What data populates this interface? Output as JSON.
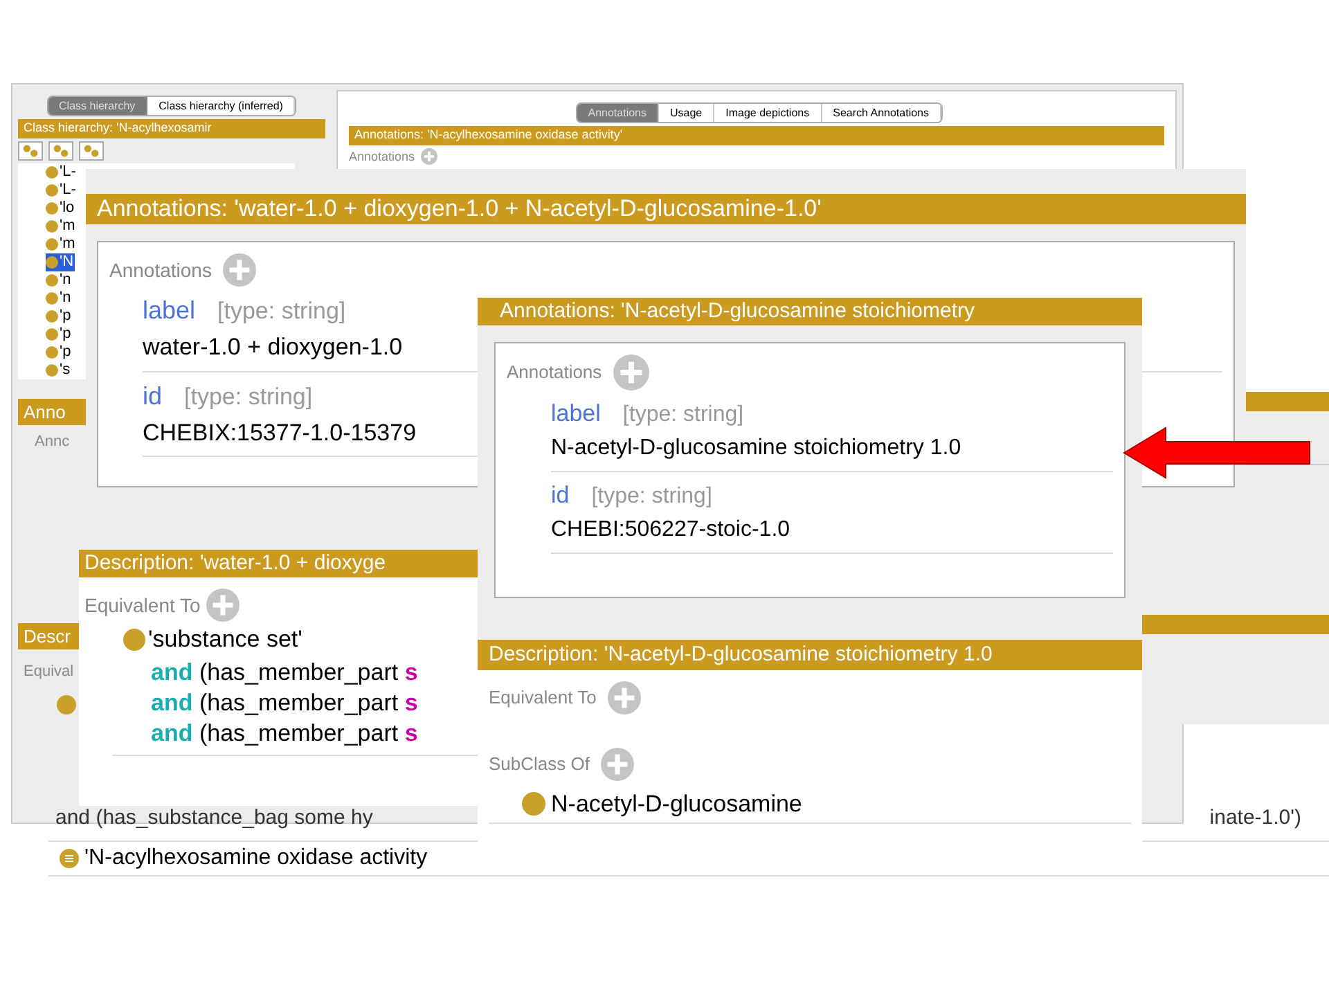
{
  "back_window": {
    "hierarchy_tabs": [
      {
        "label": "Class hierarchy",
        "selected": true
      },
      {
        "label": "Class hierarchy (inferred)",
        "selected": false
      }
    ],
    "hierarchy_header": "Class hierarchy: 'N-acylhexosamir",
    "tree_items": [
      {
        "label": "'L-",
        "selected": false
      },
      {
        "label": "'L-",
        "selected": false
      },
      {
        "label": "'lo",
        "selected": false
      },
      {
        "label": "'m",
        "selected": false
      },
      {
        "label": "'m",
        "selected": false
      },
      {
        "label": "'N",
        "selected": true
      },
      {
        "label": "'n",
        "selected": false
      },
      {
        "label": "'n",
        "selected": false
      },
      {
        "label": "'p",
        "selected": false
      },
      {
        "label": "'p",
        "selected": false
      },
      {
        "label": "'p",
        "selected": false
      },
      {
        "label": "'s",
        "selected": false
      }
    ],
    "annotation_tabs": [
      {
        "label": "Annotations",
        "selected": true
      },
      {
        "label": "Usage",
        "selected": false
      },
      {
        "label": "Image depictions",
        "selected": false
      },
      {
        "label": "Search Annotations",
        "selected": false
      }
    ],
    "annotations_header": "Annotations: 'N-acylhexosamine oxidase activity'",
    "annotations_label": "Annotations",
    "lower_header": "Anno",
    "lower_annotations_label": "Annc",
    "description_header": "Descr",
    "equivalent_label": "Equival",
    "bottom_rows": [
      "and (has_substance_bag some hy",
      "inate-1.0')"
    ],
    "class_row": "'N-acylhexosamine oxidase activity"
  },
  "reaction_window": {
    "annotations_header": "Annotations: 'water-1.0 + dioxygen-1.0 + N-acetyl-D-glucosamine-1.0'",
    "annotations_label": "Annotations",
    "annotations": [
      {
        "property": "label",
        "type": "[type: string]",
        "value": "water-1.0 + dioxygen-1.0"
      },
      {
        "property": "id",
        "type": "[type: string]",
        "value": "CHEBIX:15377-1.0-15379"
      }
    ],
    "description_header": "Description: 'water-1.0 + dioxyge",
    "equivalent_label": "Equivalent To",
    "equivalent_class": "'substance set'",
    "restrictions": [
      {
        "keyword": "and",
        "text": "(has_member_part",
        "suffix": "s"
      },
      {
        "keyword": "and",
        "text": "(has_member_part",
        "suffix": "s"
      },
      {
        "keyword": "and",
        "text": "(has_member_part",
        "suffix": "s"
      }
    ]
  },
  "stoichiometry_window": {
    "annotations_header": "Annotations: 'N-acetyl-D-glucosamine stoichiometry",
    "annotations_label": "Annotations",
    "annotations": [
      {
        "property": "label",
        "type": "[type: string]",
        "value": "N-acetyl-D-glucosamine stoichiometry 1.0"
      },
      {
        "property": "id",
        "type": "[type: string]",
        "value": "CHEBI:506227-stoic-1.0"
      }
    ],
    "description_header": "Description: 'N-acetyl-D-glucosamine stoichiometry 1.0",
    "equivalent_label": "Equivalent To",
    "subclass_label": "SubClass Of",
    "superclass": "N-acetyl-D-glucosamine"
  }
}
